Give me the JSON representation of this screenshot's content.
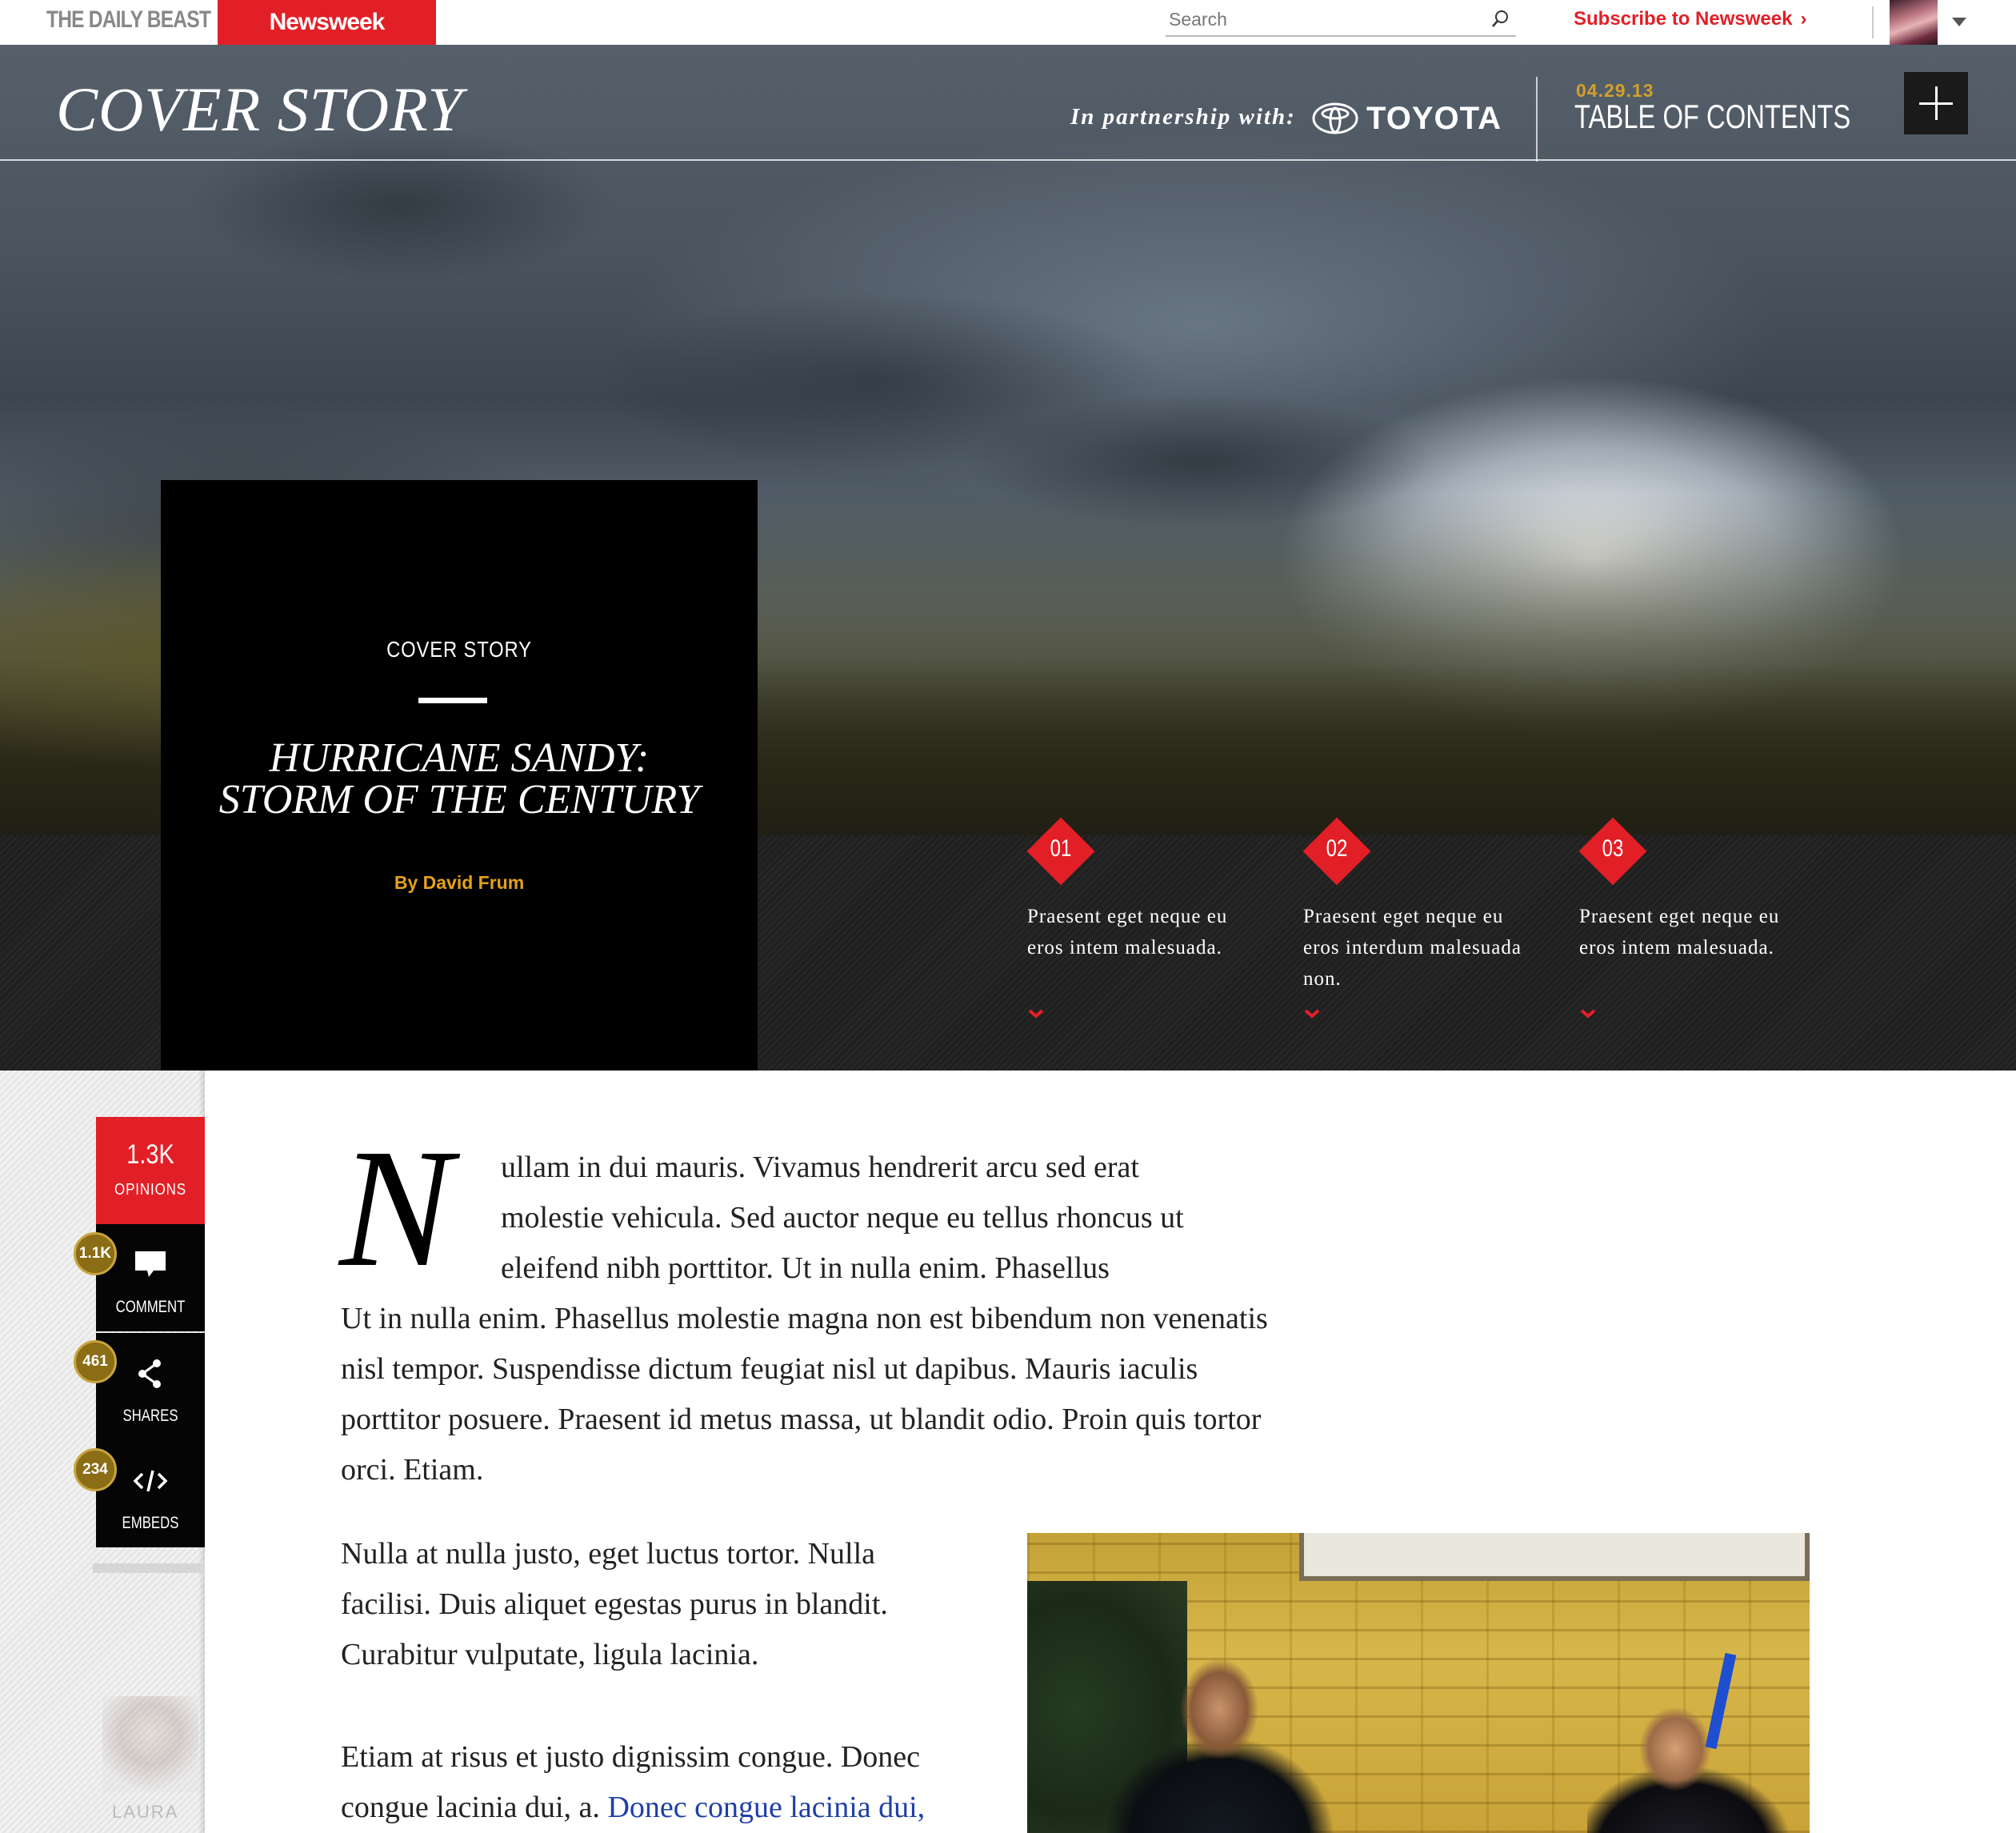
{
  "topbar": {
    "brand_primary": "THE DAILY BEAST",
    "brand_secondary": "Newsweek",
    "search_placeholder": "Search",
    "subscribe_label": "Subscribe to Newsweek",
    "subscribe_chevron": "›"
  },
  "hero": {
    "section_title": "COVER STORY",
    "partner_label": "In partnership with:",
    "partner_name": "TOYOTA",
    "toc_date": "04.29.13",
    "toc_label": "TABLE OF CONTENTS"
  },
  "story": {
    "kicker": "COVER STORY",
    "headline_line1": "HURRICANE SANDY:",
    "headline_line2": "STORM OF THE CENTURY",
    "byline": "By David Frum"
  },
  "chapters": [
    {
      "number": "01",
      "text": "Praesent eget neque eu eros intem malesuada."
    },
    {
      "number": "02",
      "text": "Praesent eget neque eu eros interdum malesuada non."
    },
    {
      "number": "03",
      "text": "Praesent eget neque eu eros intem malesuada."
    }
  ],
  "social": {
    "opinions_count": "1.3K",
    "opinions_label": "OPINIONS",
    "comment_count": "1.1K",
    "comment_label": "COMMENT",
    "shares_count": "461",
    "shares_label": "SHARES",
    "embeds_count": "234",
    "embeds_label": "EMBEDS",
    "faded_name": "LAURA"
  },
  "article": {
    "dropcap": "N",
    "p1_line1": "ullam in dui mauris. Vivamus hendrerit arcu sed erat",
    "p1_line2": "molestie vehicula. Sed auctor neque eu tellus rhoncus ut",
    "p1_line3": "eleifend nibh porttitor. Ut in nulla enim. Phasellus",
    "p1_rest": "Ut in nulla enim. Phasellus molestie magna non est bibendum non venenatis nisl tempor. Suspendisse dictum feugiat nisl ut dapibus. Mauris iaculis porttitor posuere. Praesent id metus massa, ut blandit odio. Proin quis tortor orci. Etiam.",
    "p2": "Nulla at nulla justo, eget luctus tortor. Nulla facilisi. Duis aliquet egestas purus in blandit. Curabitur vulputate, ligula lacinia.",
    "p3_text": "Etiam at risus et justo dignissim congue. Donec congue lacinia dui, a.",
    "p3_link": "Donec congue lacinia dui,"
  },
  "colors": {
    "accent_red": "#e21f26",
    "byline_gold": "#e3a21a",
    "badge_gold": "#8a6d14",
    "link_blue": "#1f3fa8"
  },
  "icons": [
    "search-icon",
    "chevron-right-icon",
    "caret-down-icon",
    "toyota-logo-icon",
    "plus-icon",
    "chevron-down-icon",
    "comment-icon",
    "share-icon",
    "code-icon"
  ]
}
